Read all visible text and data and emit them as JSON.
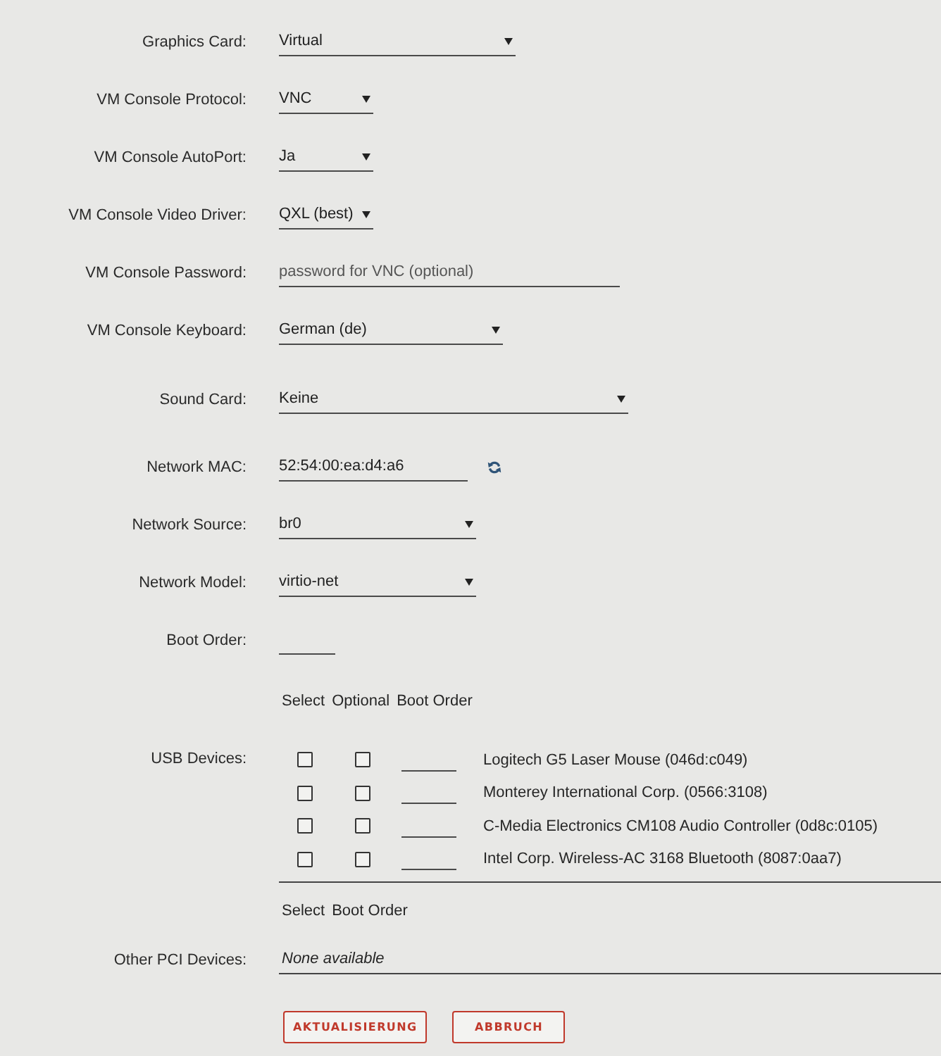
{
  "sections": [
    {
      "fields": [
        {
          "kind": "select",
          "label": "Graphics Card:",
          "value": "Virtual"
        },
        {
          "kind": "select",
          "label": "VM Console Protocol:",
          "value": "VNC"
        },
        {
          "kind": "select",
          "label": "VM Console AutoPort:",
          "value": "Ja"
        },
        {
          "kind": "select",
          "label": "VM Console Video Driver:",
          "value": "QXL (best)"
        },
        {
          "kind": "password",
          "label": "VM Console Password:",
          "placeholder": "password for VNC (optional)"
        },
        {
          "kind": "select",
          "label": "VM Console Keyboard:",
          "value": "German (de)"
        }
      ]
    },
    {
      "fields": [
        {
          "kind": "select",
          "label": "Sound Card:",
          "value": "Keine"
        }
      ]
    },
    {
      "fields": [
        {
          "kind": "mac",
          "label": "Network MAC:",
          "value": "52:54:00:ea:d4:a6"
        },
        {
          "kind": "select",
          "label": "Network Source:",
          "value": "br0"
        },
        {
          "kind": "select",
          "label": "Network Model:",
          "value": "virtio-net"
        },
        {
          "kind": "boot_order",
          "label": "Boot Order:"
        }
      ]
    }
  ],
  "usb": {
    "label": "USB Devices:",
    "columns": [
      "Select",
      "Optional",
      "Boot Order"
    ],
    "devices": [
      {
        "name": "Logitech G5 Laser Mouse (046d:c049)",
        "selected": false,
        "optional": false
      },
      {
        "name": "Monterey International Corp. (0566:3108)",
        "selected": false,
        "optional": false
      },
      {
        "name": "C-Media Electronics CM108 Audio Controller (0d8c:0105)",
        "selected": false,
        "optional": false
      },
      {
        "name": "Intel Corp. Wireless-AC 3168 Bluetooth (8087:0aa7)",
        "selected": false,
        "optional": false
      }
    ]
  },
  "pci": {
    "columns": [
      "Select",
      "Boot Order"
    ],
    "label": "Other PCI Devices:",
    "value": "None available"
  },
  "buttons": [
    "AKTUALISIERUNG",
    "ABBRUCH"
  ]
}
